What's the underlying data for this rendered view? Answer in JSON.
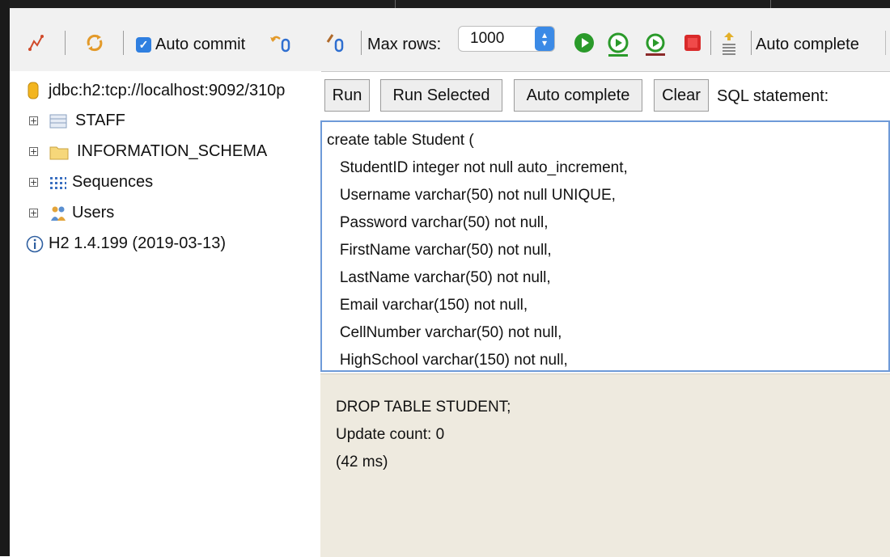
{
  "toolbar": {
    "auto_commit_label": "Auto commit",
    "max_rows_label": "Max rows:",
    "max_rows_value": "1000",
    "auto_complete_label": "Auto complete",
    "accent_color": "#2f7fe0"
  },
  "tree": {
    "connection": "jdbc:h2:tcp://localhost:9092/310p",
    "items": [
      {
        "label": "STAFF",
        "icon": "table-icon"
      },
      {
        "label": "INFORMATION_SCHEMA",
        "icon": "folder-icon"
      },
      {
        "label": "Sequences",
        "icon": "sequences-icon"
      },
      {
        "label": "Users",
        "icon": "users-icon"
      }
    ],
    "version": "H2 1.4.199 (2019-03-13)"
  },
  "editor": {
    "run_label": "Run",
    "run_selected_label": "Run Selected",
    "auto_complete_label": "Auto complete",
    "clear_label": "Clear",
    "sql_statement_label": "SQL statement:",
    "sql_lines": [
      "create table Student (",
      "   StudentID integer not null auto_increment,",
      "   Username varchar(50) not null UNIQUE,",
      "   Password varchar(50) not null,",
      "   FirstName varchar(50) not null,",
      "   LastName varchar(50) not null,",
      "   Email varchar(150) not null,",
      "   CellNumber varchar(50) not null,",
      "   HighSchool varchar(150) not null,"
    ]
  },
  "result": {
    "lines": [
      "DROP TABLE STUDENT;",
      "Update count: 0",
      "(42 ms)"
    ]
  }
}
